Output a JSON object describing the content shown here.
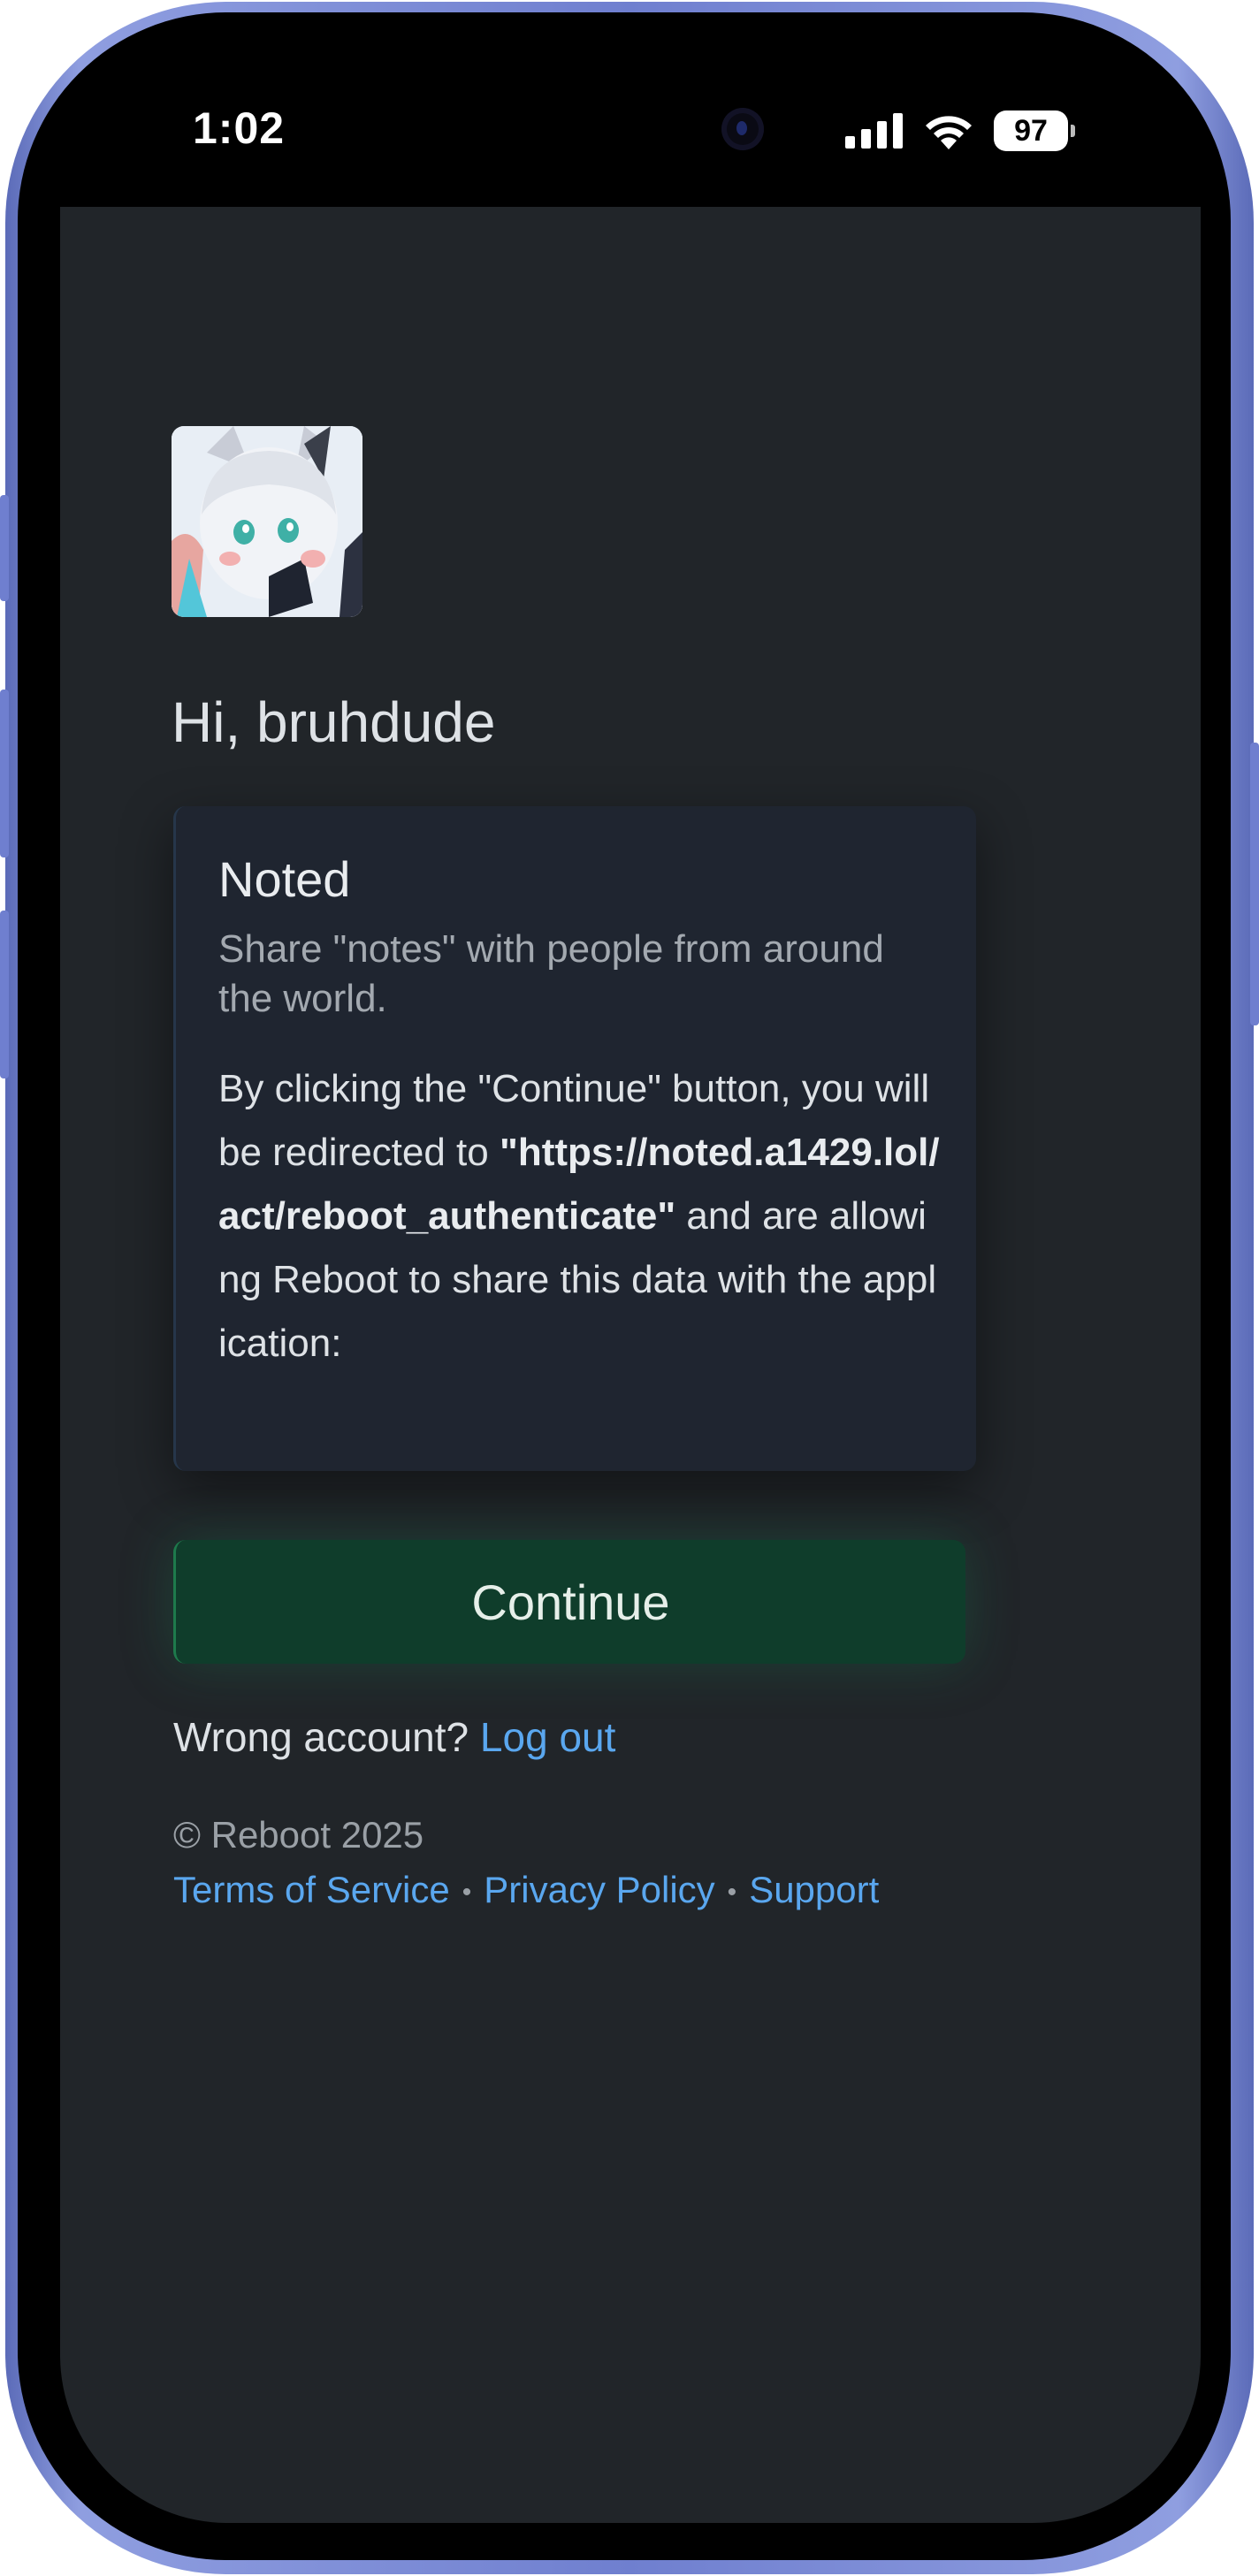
{
  "status_bar": {
    "time": "1:02",
    "battery": "97",
    "icons": [
      "signal-icon",
      "wifi-icon",
      "battery-icon"
    ]
  },
  "user": {
    "greeting": "Hi, bruhdude",
    "avatar_description_icon": "avatar-image"
  },
  "app": {
    "name": "Noted",
    "description": "Share \"notes\" with people from around the world.",
    "consent_prefix": "By clicking the \"Continue\" button, you will be redirected to ",
    "redirect_url": "\"https://noted.a1429.lol/act/reboot_authenticate\"",
    "consent_suffix": " and are allowing Reboot to share this data with the application:"
  },
  "actions": {
    "continue_label": "Continue",
    "wrong_account_text": "Wrong account?",
    "logout_label": "Log out"
  },
  "footer": {
    "copyright": "© Reboot 2025",
    "links": [
      "Terms of Service",
      "Privacy Policy",
      "Support"
    ],
    "separator": "•"
  },
  "colors": {
    "background": "#212529",
    "card": "#1f2530",
    "continue_button": "#0f3d2b",
    "link": "#5aa7ef",
    "phone_frame": "#6f7fcf"
  }
}
